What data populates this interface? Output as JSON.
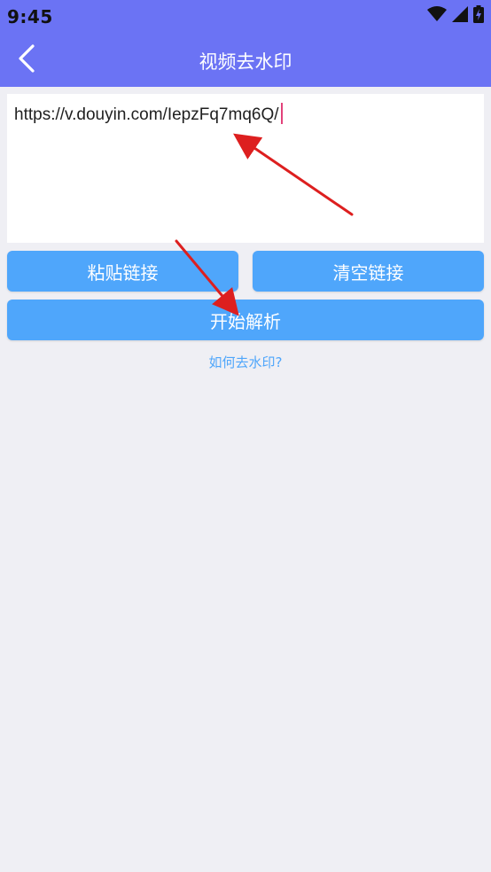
{
  "status_bar": {
    "time": "9:45",
    "icons": [
      "wifi-icon",
      "signal-icon",
      "battery-charging-icon"
    ]
  },
  "header": {
    "title": "视频去水印",
    "back_icon": "chevron-left-icon"
  },
  "link_input": {
    "value": "https://v.douyin.com/IepzFq7mq6Q/"
  },
  "buttons": {
    "paste_label": "粘贴链接",
    "clear_label": "清空链接",
    "parse_label": "开始解析"
  },
  "help": {
    "link_text": "如何去水印?"
  },
  "colors": {
    "accent": "#6b73f4",
    "button": "#4fa6fb",
    "background": "#efeff4",
    "caret": "#e2427a",
    "annotation_arrow": "#dd1f1f"
  }
}
